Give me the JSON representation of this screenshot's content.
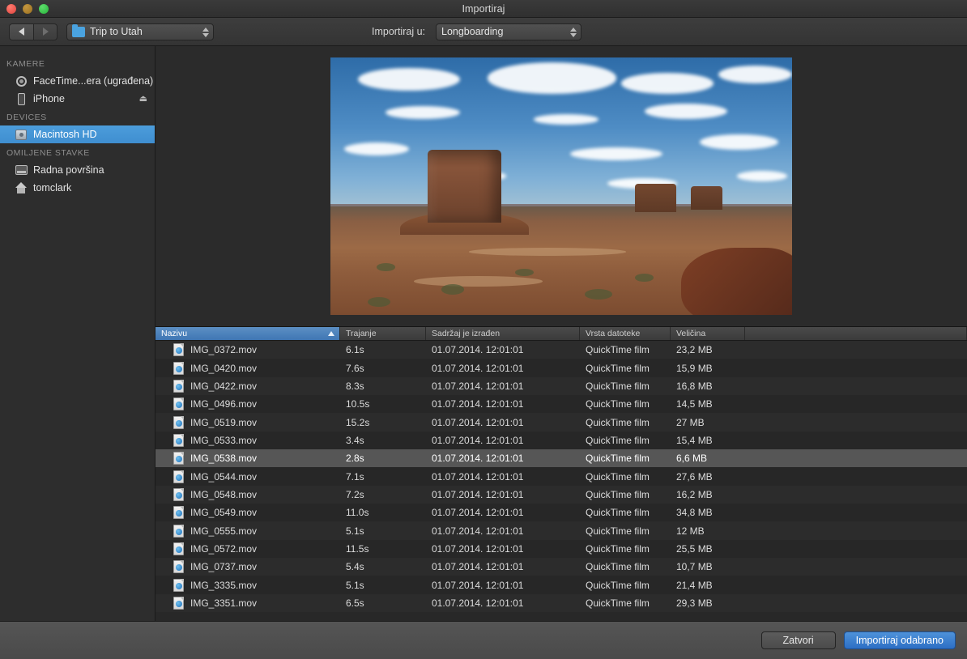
{
  "window": {
    "title": "Importiraj",
    "traffic_lights": [
      "close-button",
      "minimize-button",
      "maximize-button"
    ]
  },
  "toolbar": {
    "back_icon": "back-arrow-icon",
    "forward_icon": "forward-arrow-icon",
    "folder_popup": {
      "value": "Trip to Utah",
      "icon": "folder-icon"
    },
    "import_to_label": "Importiraj u:",
    "destination_popup": {
      "value": "Longboarding"
    }
  },
  "sidebar": {
    "sections": [
      {
        "header": "KAMERE",
        "items": [
          {
            "label": "FaceTime...era (ugrađena)",
            "icon": "camera-icon",
            "selected": false,
            "eject": false
          },
          {
            "label": "iPhone",
            "icon": "phone-icon",
            "selected": false,
            "eject": true
          }
        ]
      },
      {
        "header": "DEVICES",
        "items": [
          {
            "label": "Macintosh HD",
            "icon": "hard-disk-icon",
            "selected": true,
            "eject": false
          }
        ]
      },
      {
        "header": "OMILJENE STAVKE",
        "items": [
          {
            "label": "Radna površina",
            "icon": "desktop-icon",
            "selected": false,
            "eject": false
          },
          {
            "label": "tomclark",
            "icon": "home-icon",
            "selected": false,
            "eject": false
          }
        ]
      }
    ],
    "eject_glyph": "⏏"
  },
  "preview": {
    "alt": "Monument Valley desert landscape with butte under blue sky"
  },
  "table": {
    "columns": [
      {
        "key": "name",
        "label": "Nazivu",
        "sorted": true,
        "sort_direction": "ascending"
      },
      {
        "key": "duration",
        "label": "Trajanje",
        "sorted": false
      },
      {
        "key": "date",
        "label": "Sadržaj je izrađen",
        "sorted": false
      },
      {
        "key": "type",
        "label": "Vrsta datoteke",
        "sorted": false
      },
      {
        "key": "size",
        "label": "Veličina",
        "sorted": false
      }
    ],
    "rows": [
      {
        "name": "IMG_0372.mov",
        "duration": "6.1s",
        "date": "01.07.2014. 12:01:01",
        "type": "QuickTime film",
        "size": "23,2 MB",
        "selected": false
      },
      {
        "name": "IMG_0420.mov",
        "duration": "7.6s",
        "date": "01.07.2014. 12:01:01",
        "type": "QuickTime film",
        "size": "15,9 MB",
        "selected": false
      },
      {
        "name": "IMG_0422.mov",
        "duration": "8.3s",
        "date": "01.07.2014. 12:01:01",
        "type": "QuickTime film",
        "size": "16,8 MB",
        "selected": false
      },
      {
        "name": "IMG_0496.mov",
        "duration": "10.5s",
        "date": "01.07.2014. 12:01:01",
        "type": "QuickTime film",
        "size": "14,5 MB",
        "selected": false
      },
      {
        "name": "IMG_0519.mov",
        "duration": "15.2s",
        "date": "01.07.2014. 12:01:01",
        "type": "QuickTime film",
        "size": "27 MB",
        "selected": false
      },
      {
        "name": "IMG_0533.mov",
        "duration": "3.4s",
        "date": "01.07.2014. 12:01:01",
        "type": "QuickTime film",
        "size": "15,4 MB",
        "selected": false
      },
      {
        "name": "IMG_0538.mov",
        "duration": "2.8s",
        "date": "01.07.2014. 12:01:01",
        "type": "QuickTime film",
        "size": "6,6 MB",
        "selected": true
      },
      {
        "name": "IMG_0544.mov",
        "duration": "7.1s",
        "date": "01.07.2014. 12:01:01",
        "type": "QuickTime film",
        "size": "27,6 MB",
        "selected": false
      },
      {
        "name": "IMG_0548.mov",
        "duration": "7.2s",
        "date": "01.07.2014. 12:01:01",
        "type": "QuickTime film",
        "size": "16,2 MB",
        "selected": false
      },
      {
        "name": "IMG_0549.mov",
        "duration": "11.0s",
        "date": "01.07.2014. 12:01:01",
        "type": "QuickTime film",
        "size": "34,8 MB",
        "selected": false
      },
      {
        "name": "IMG_0555.mov",
        "duration": "5.1s",
        "date": "01.07.2014. 12:01:01",
        "type": "QuickTime film",
        "size": "12 MB",
        "selected": false
      },
      {
        "name": "IMG_0572.mov",
        "duration": "11.5s",
        "date": "01.07.2014. 12:01:01",
        "type": "QuickTime film",
        "size": "25,5 MB",
        "selected": false
      },
      {
        "name": "IMG_0737.mov",
        "duration": "5.4s",
        "date": "01.07.2014. 12:01:01",
        "type": "QuickTime film",
        "size": "10,7 MB",
        "selected": false
      },
      {
        "name": "IMG_3335.mov",
        "duration": "5.1s",
        "date": "01.07.2014. 12:01:01",
        "type": "QuickTime film",
        "size": "21,4 MB",
        "selected": false
      },
      {
        "name": "IMG_3351.mov",
        "duration": "6.5s",
        "date": "01.07.2014. 12:01:01",
        "type": "QuickTime film",
        "size": "29,3 MB",
        "selected": false
      }
    ]
  },
  "footer": {
    "close_label": "Zatvori",
    "import_label": "Importiraj odabrano"
  },
  "colors": {
    "accent_blue": "#3f8ed0",
    "primary_button": "#2d6fc4",
    "selection_row": "#565656",
    "window_bg": "#2b2b2b",
    "sidebar_bg": "#2d2d2d"
  }
}
